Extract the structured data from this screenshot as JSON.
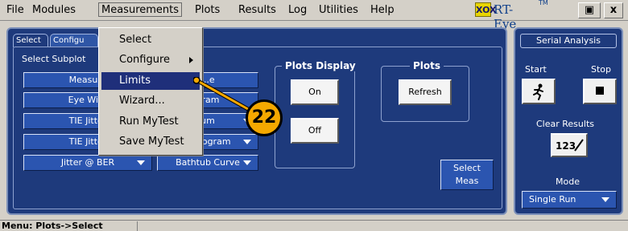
{
  "menubar": {
    "items": [
      "File",
      "Modules",
      "Measurements",
      "Plots",
      "Results",
      "Log",
      "Utilities",
      "Help"
    ],
    "logo_mark": "XOX",
    "logo_text": "RT-Eye",
    "logo_tm": "TM",
    "window_buttons": [
      "▣",
      "x"
    ]
  },
  "tabs": [
    "Select",
    "Configu"
  ],
  "left": {
    "subplot_label": "Select Subplot",
    "left_buttons": [
      "Measure",
      "Eye Widt",
      "TIE Jitter",
      "TIE Jitter",
      "Jitter @ BER"
    ],
    "right_buttons": [
      "...e",
      "gram",
      "um",
      "Histogram",
      "Bathtub Curve"
    ]
  },
  "plots_display": {
    "title": "Plots Display",
    "on_label": "On",
    "off_label": "Off"
  },
  "plots": {
    "title": "Plots",
    "refresh_label": "Refresh"
  },
  "select_meas": {
    "label_line1": "Select",
    "label_line2": "Meas"
  },
  "right_panel": {
    "title": "Serial Analysis",
    "start_label": "Start",
    "stop_label": "Stop",
    "clear_label": "Clear Results",
    "counter_glyph": "123",
    "mode_label": "Mode",
    "mode_value": "Single Run"
  },
  "dropdown": {
    "items": [
      {
        "label": "Select",
        "submenu": false,
        "highlighted": false
      },
      {
        "label": "Configure",
        "submenu": true,
        "highlighted": false
      },
      {
        "label": "Limits",
        "submenu": false,
        "highlighted": true
      },
      {
        "label": "Wizard...",
        "submenu": false,
        "highlighted": false
      },
      {
        "label": "Run MyTest",
        "submenu": false,
        "highlighted": false
      },
      {
        "label": "Save MyTest",
        "submenu": false,
        "highlighted": false
      }
    ]
  },
  "callout": {
    "number": "22"
  },
  "status": {
    "text": "Menu: Plots->Select"
  },
  "colors": {
    "panel_blue": "#1e3a7c",
    "button_blue": "#2b55b0",
    "callout_orange": "#f5a800",
    "menu_highlight": "#1f2f7a"
  }
}
